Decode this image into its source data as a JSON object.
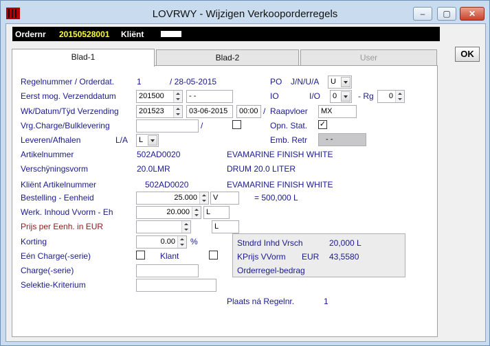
{
  "window": {
    "title": "LOVRWY - Wijzigen Verkooporderregels",
    "minimize": "–",
    "maximize": "▢",
    "close": "✕"
  },
  "header": {
    "order_label": "Ordernr",
    "order_value": "20150528001",
    "client_label": "Kliënt"
  },
  "tabs": [
    {
      "label": "Blad-1"
    },
    {
      "label": "Blad-2"
    },
    {
      "label": "User"
    }
  ],
  "ok_label": "OK",
  "form": {
    "regelnummer_label": "Regelnummer / Orderdat.",
    "regelnummer_value": "1",
    "orderdat_value": "/ 28-05-2015",
    "eerst_label": "Eerst mog. Verzenddatum",
    "eerst_week": "201500",
    "eerst_date": "- -",
    "wk_label": "Wk/Datum/Tÿd Verzending",
    "wk_week": "201523",
    "wk_date": "03-06-2015",
    "wk_time": "00:00",
    "wk_sep": "/",
    "vrg_label": "Vrg.Charge/Bulklevering",
    "vrg_sep": "/",
    "leveren_label": "Leveren/Afhalen",
    "leveren_la": "L/A",
    "leveren_value": "L",
    "po_label": "PO",
    "po_jnua": "J/N/U/A",
    "po_value": "U",
    "io_label": "IO",
    "io_io": "I/O",
    "io_value": "0",
    "rg_label": "- Rg",
    "rg_value": "0",
    "raapvloer_label": "Raapvloer",
    "raapvloer_value": "MX",
    "opn_label": "Opn. Stat.",
    "opn_checked": "✓",
    "emb_label": "Emb. Retr",
    "emb_value": "- -",
    "artikel_label": "Artikelnummer",
    "artikel_value": "502AD0020",
    "artikel_desc": "EVAMARINE FINISH WHITE",
    "verschijning_label": "Verschÿningsvorm",
    "verschijning_value": "20.0LMR",
    "verschijning_desc": "DRUM 20.0 LITER",
    "klient_art_label": "Kliënt Artikelnummer",
    "klient_art_value": "502AD0020",
    "klient_art_desc": "EVAMARINE FINISH WHITE",
    "bestelling_label": "Bestelling - Eenheid",
    "bestelling_value": "25.000",
    "bestelling_unit": "V",
    "bestelling_total": "= 500,000 L",
    "werk_label": "Werk. Inhoud Vvorm - Eh",
    "werk_value": "20.000",
    "werk_unit": "L",
    "prijs_label": "Prijs per Eenh. in EUR",
    "prijs_value": "",
    "prijs_unit": "L",
    "korting_label": "Korting",
    "korting_value": "0.00",
    "korting_pct": "%",
    "een_charge_label": "Eén Charge(-serie)",
    "klant_label": "Klant",
    "charge_label": "Charge(-serie)",
    "selektie_label": "Selektie-Kriterium",
    "plaats_label": "Plaats ná Regelnr.",
    "plaats_value": "1"
  },
  "info": {
    "stndrd_label": "Stndrd Inhd Vrsch",
    "stndrd_value": "20,000 L",
    "kprijs_label": "KPrijs VVorm",
    "kprijs_cur": "EUR",
    "kprijs_value": "43,5580",
    "orderregel_label": "Orderregel-bedrag"
  }
}
